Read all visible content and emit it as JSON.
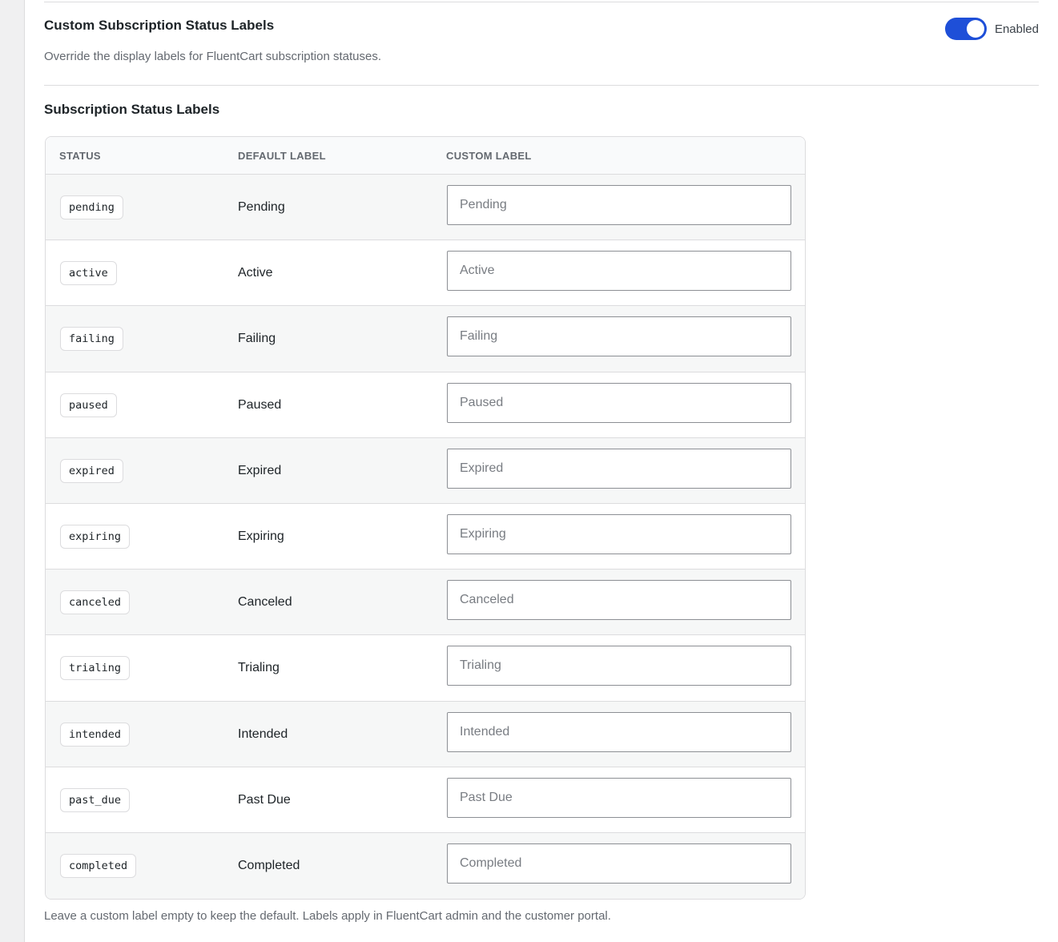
{
  "header": {
    "title": "Custom Subscription Status Labels",
    "description": "Override the display labels for FluentCart subscription statuses.",
    "toggle_label": "Enabled",
    "toggle_on": true
  },
  "section": {
    "title": "Subscription Status Labels"
  },
  "table": {
    "columns": [
      "STATUS",
      "DEFAULT LABEL",
      "CUSTOM LABEL"
    ],
    "rows": [
      {
        "status": "pending",
        "default_label": "Pending",
        "placeholder": "Pending",
        "value": ""
      },
      {
        "status": "active",
        "default_label": "Active",
        "placeholder": "Active",
        "value": ""
      },
      {
        "status": "failing",
        "default_label": "Failing",
        "placeholder": "Failing",
        "value": ""
      },
      {
        "status": "paused",
        "default_label": "Paused",
        "placeholder": "Paused",
        "value": ""
      },
      {
        "status": "expired",
        "default_label": "Expired",
        "placeholder": "Expired",
        "value": ""
      },
      {
        "status": "expiring",
        "default_label": "Expiring",
        "placeholder": "Expiring",
        "value": ""
      },
      {
        "status": "canceled",
        "default_label": "Canceled",
        "placeholder": "Canceled",
        "value": ""
      },
      {
        "status": "trialing",
        "default_label": "Trialing",
        "placeholder": "Trialing",
        "value": ""
      },
      {
        "status": "intended",
        "default_label": "Intended",
        "placeholder": "Intended",
        "value": ""
      },
      {
        "status": "past_due",
        "default_label": "Past Due",
        "placeholder": "Past Due",
        "value": ""
      },
      {
        "status": "completed",
        "default_label": "Completed",
        "placeholder": "Completed",
        "value": ""
      }
    ]
  },
  "footer": {
    "note": "Leave a custom label empty to keep the default. Labels apply in FluentCart admin and the customer portal."
  },
  "colors": {
    "accent": "#1e4fd8",
    "border": "#dcdcde",
    "row_alt": "#f6f7f7",
    "muted_text": "#646970"
  }
}
